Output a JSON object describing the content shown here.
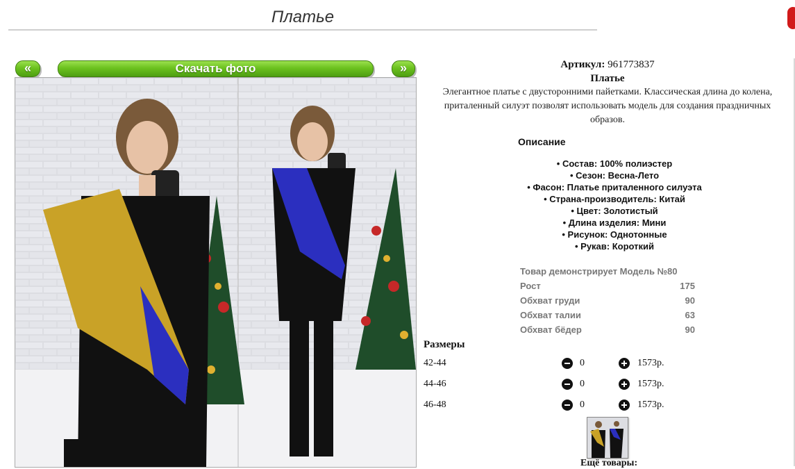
{
  "page": {
    "title": "Платье"
  },
  "gallery": {
    "prev_label": "«",
    "download_label": "Скачать фото",
    "next_label": "»"
  },
  "product": {
    "sku_label": "Артикул:",
    "sku_value": "961773837",
    "name": "Платье",
    "description": "Элегантное платье с двусторонними пайетками. Классическая длина до колена, приталенный силуэт позволят использовать модель для создания праздничных образов."
  },
  "details": {
    "title": "Описание",
    "items": [
      "• Состав: 100% полиэстер",
      "• Сезон: Весна-Лето",
      "• Фасон: Платье приталенного силуэта",
      "• Страна-производитель: Китай",
      "• Цвет: Золотистый",
      "• Длина изделия: Мини",
      "• Рисунок: Однотонные",
      "• Рукав: Короткий"
    ]
  },
  "model": {
    "heading": "Товар демонстрирует Модель №80",
    "rows": [
      {
        "label": "Рост",
        "value": "175"
      },
      {
        "label": "Обхват груди",
        "value": "90"
      },
      {
        "label": "Обхват талии",
        "value": "63"
      },
      {
        "label": "Обхват бёдер",
        "value": "90"
      }
    ]
  },
  "sizes": {
    "title": "Размеры",
    "rows": [
      {
        "size": "42-44",
        "qty": "0",
        "price": "1573р."
      },
      {
        "size": "44-46",
        "qty": "0",
        "price": "1573р."
      },
      {
        "size": "46-48",
        "qty": "0",
        "price": "1573р."
      }
    ]
  },
  "more": {
    "label": "Ещё товары:"
  },
  "colors": {
    "accent_green": "#6cc21f",
    "dress_gold": "#c9a227",
    "dress_blue": "#2b2fbf",
    "dress_black": "#111111"
  }
}
